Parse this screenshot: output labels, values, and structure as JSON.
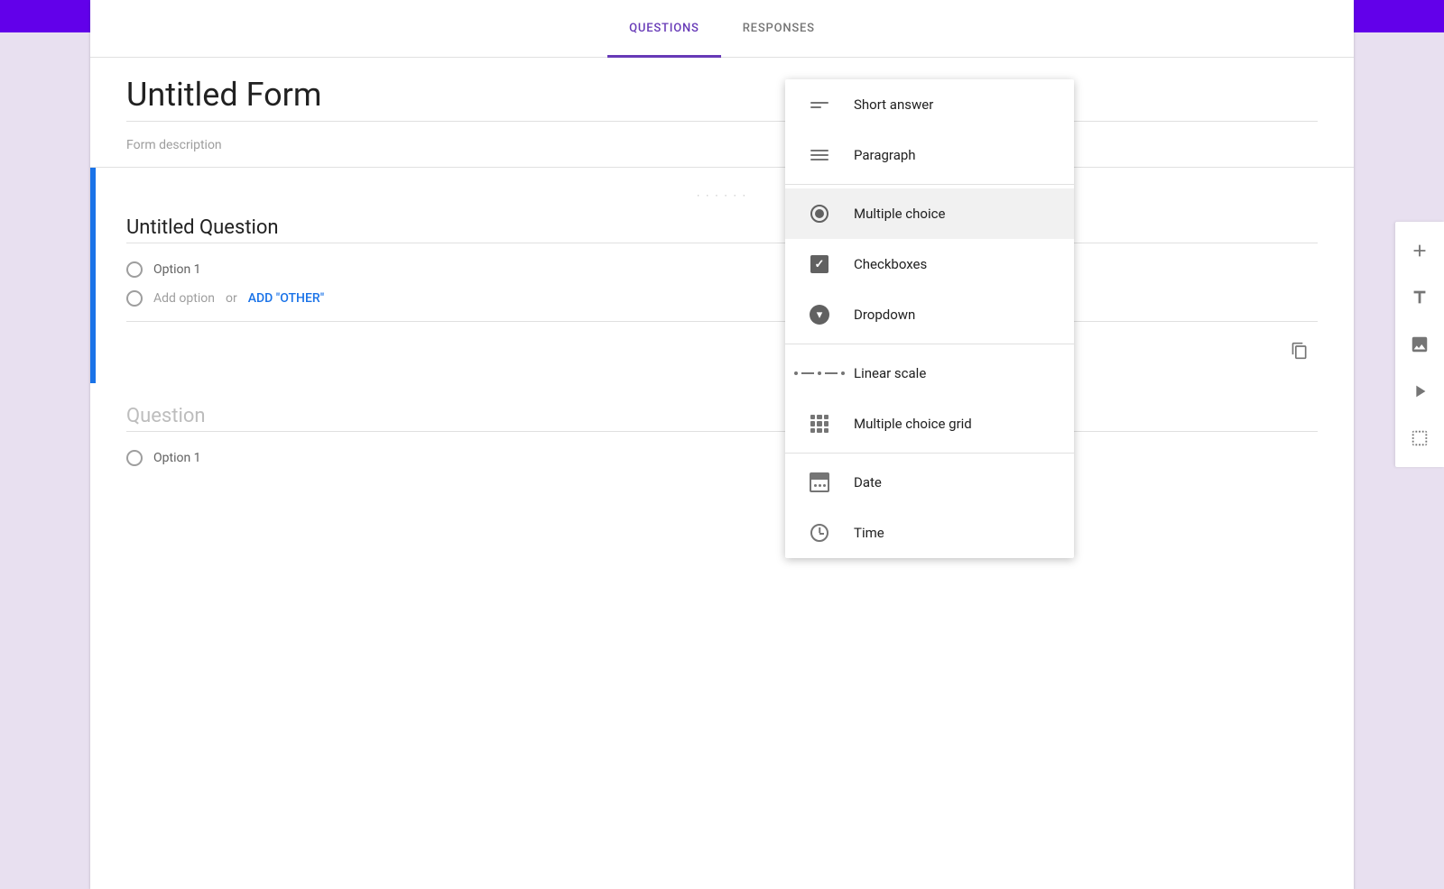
{
  "app": {
    "bg_color": "#e8e0f0",
    "top_bar_color": "#6200ea"
  },
  "header": {
    "tabs": [
      {
        "label": "QUESTIONS",
        "active": true
      },
      {
        "label": "RESPONSES",
        "active": false
      }
    ]
  },
  "form": {
    "title": "Untitled Form",
    "description_placeholder": "Form description"
  },
  "question_card": {
    "drag_handle": "· · · · · ·",
    "title": "Untitled Question",
    "options": [
      {
        "label": "Option 1"
      }
    ],
    "add_option_text": "Add option",
    "add_option_or": "or",
    "add_other_label": "ADD \"OTHER\""
  },
  "question_card_2": {
    "title_placeholder": "Question",
    "options": [
      {
        "label": "Option 1"
      }
    ]
  },
  "dropdown_menu": {
    "items": [
      {
        "id": "short-answer",
        "label": "Short answer",
        "icon": "short-answer-icon",
        "selected": false,
        "divider_after": false
      },
      {
        "id": "paragraph",
        "label": "Paragraph",
        "icon": "paragraph-icon",
        "selected": false,
        "divider_after": true
      },
      {
        "id": "multiple-choice",
        "label": "Multiple choice",
        "icon": "radio-icon",
        "selected": true,
        "divider_after": false
      },
      {
        "id": "checkboxes",
        "label": "Checkboxes",
        "icon": "checkbox-icon",
        "selected": false,
        "divider_after": false
      },
      {
        "id": "dropdown",
        "label": "Dropdown",
        "icon": "dropdown-icon",
        "selected": false,
        "divider_after": true
      },
      {
        "id": "linear-scale",
        "label": "Linear scale",
        "icon": "linear-scale-icon",
        "selected": false,
        "divider_after": false
      },
      {
        "id": "multiple-choice-grid",
        "label": "Multiple choice grid",
        "icon": "grid-icon",
        "selected": false,
        "divider_after": true
      },
      {
        "id": "date",
        "label": "Date",
        "icon": "date-icon",
        "selected": false,
        "divider_after": false
      },
      {
        "id": "time",
        "label": "Time",
        "icon": "time-icon",
        "selected": false,
        "divider_after": false
      }
    ]
  },
  "right_sidebar": {
    "buttons": [
      {
        "id": "add-question",
        "icon": "plus-icon",
        "label": "Add question"
      },
      {
        "id": "add-title",
        "icon": "title-icon",
        "label": "Add title"
      },
      {
        "id": "add-image",
        "icon": "image-icon",
        "label": "Add image"
      },
      {
        "id": "add-video",
        "icon": "video-icon",
        "label": "Add video"
      },
      {
        "id": "add-section",
        "icon": "section-icon",
        "label": "Add section"
      }
    ]
  }
}
